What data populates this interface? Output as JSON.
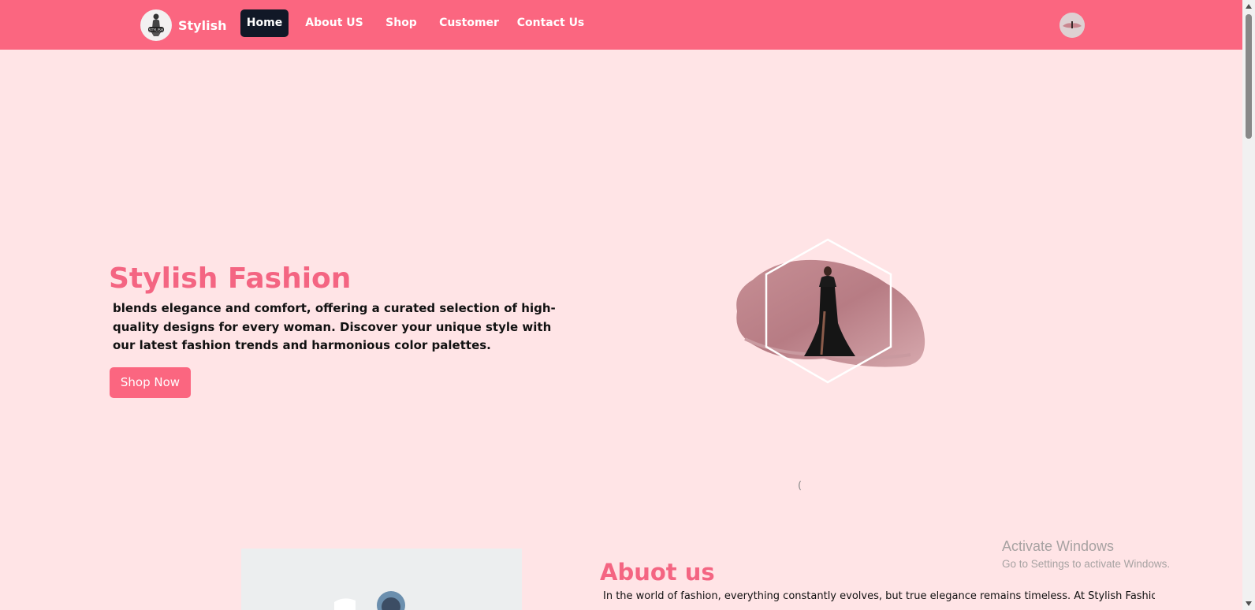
{
  "nav": {
    "brand": "Stylish",
    "logo_text": "STYLISH",
    "items": [
      {
        "label": "Home",
        "active": true
      },
      {
        "label": "About US",
        "active": false
      },
      {
        "label": "Shop",
        "active": false
      },
      {
        "label": "Customer",
        "active": false
      },
      {
        "label": "Contact Us",
        "active": false
      }
    ]
  },
  "hero": {
    "title": "Stylish Fashion",
    "description": "blends elegance and comfort, offering a curated selection of high-quality designs for every woman. Discover your unique style with our latest fashion trends and harmonious color palettes.",
    "cta": "Shop Now",
    "stray_text": "("
  },
  "about": {
    "title": "Abuot us",
    "text": "In the world of fashion, everything constantly evolves, but true elegance remains timeless. At Stylish Fashion, we"
  },
  "watermark": {
    "title": "Activate Windows",
    "subtitle": "Go to Settings to activate Windows."
  },
  "colors": {
    "accent": "#fb6680",
    "heading": "#f46582",
    "background": "#ffe4e6",
    "active_nav": "#111827"
  },
  "icons": [
    "brand-logo-icon",
    "user-avatar-icon"
  ]
}
